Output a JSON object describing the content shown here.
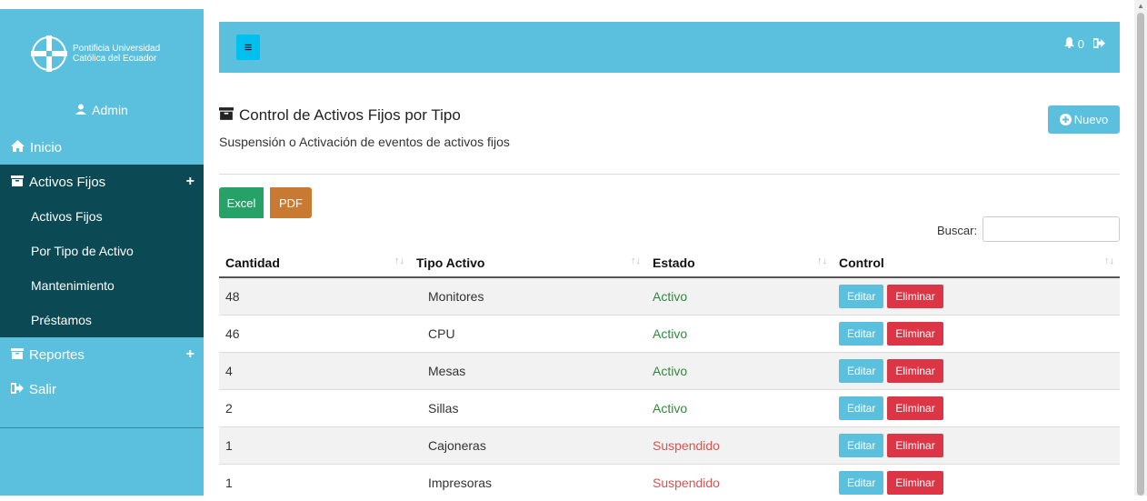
{
  "sidebar": {
    "logo_line1": "Pontificia Universidad",
    "logo_line2": "Católica del Ecuador",
    "user": "Admin",
    "items": [
      {
        "label": "Inicio",
        "icon": "home-icon"
      },
      {
        "label": "Activos Fijos",
        "icon": "archive-icon",
        "expand": "+"
      },
      {
        "label": "Reportes",
        "icon": "archive-icon",
        "expand": "+"
      },
      {
        "label": "Salir",
        "icon": "sign-out-icon"
      }
    ],
    "subitems": [
      "Activos Fijos",
      "Por Tipo de Activo",
      "Mantenimiento",
      "Préstamos"
    ]
  },
  "topbar": {
    "menu_icon": "≡",
    "notifications": "0"
  },
  "page": {
    "title": "Control de Activos Fijos por Tipo",
    "subtitle": "Suspensión o Activación de eventos de activos fijos",
    "new_button": "Nuevo",
    "excel_button": "Excel",
    "pdf_button": "PDF",
    "search_label": "Buscar:"
  },
  "table": {
    "headers": [
      "Cantidad",
      "Tipo Activo",
      "Estado",
      "Control"
    ],
    "edit_label": "Editar",
    "delete_label": "Eliminar",
    "rows": [
      {
        "cantidad": "48",
        "tipo": "Monitores",
        "estado": "Activo"
      },
      {
        "cantidad": "46",
        "tipo": "CPU",
        "estado": "Activo"
      },
      {
        "cantidad": "4",
        "tipo": "Mesas",
        "estado": "Activo"
      },
      {
        "cantidad": "2",
        "tipo": "Sillas",
        "estado": "Activo"
      },
      {
        "cantidad": "1",
        "tipo": "Cajoneras",
        "estado": "Suspendido"
      },
      {
        "cantidad": "1",
        "tipo": "Impresoras",
        "estado": "Suspendido"
      }
    ]
  },
  "colors": {
    "sidebar": "#5bc0de",
    "sidebar_active": "#0b4a55",
    "active_status": "#2e8b3c",
    "suspended_status": "#d9534f",
    "excel": "#26a269",
    "pdf": "#c87a32",
    "delete": "#dc3545"
  }
}
